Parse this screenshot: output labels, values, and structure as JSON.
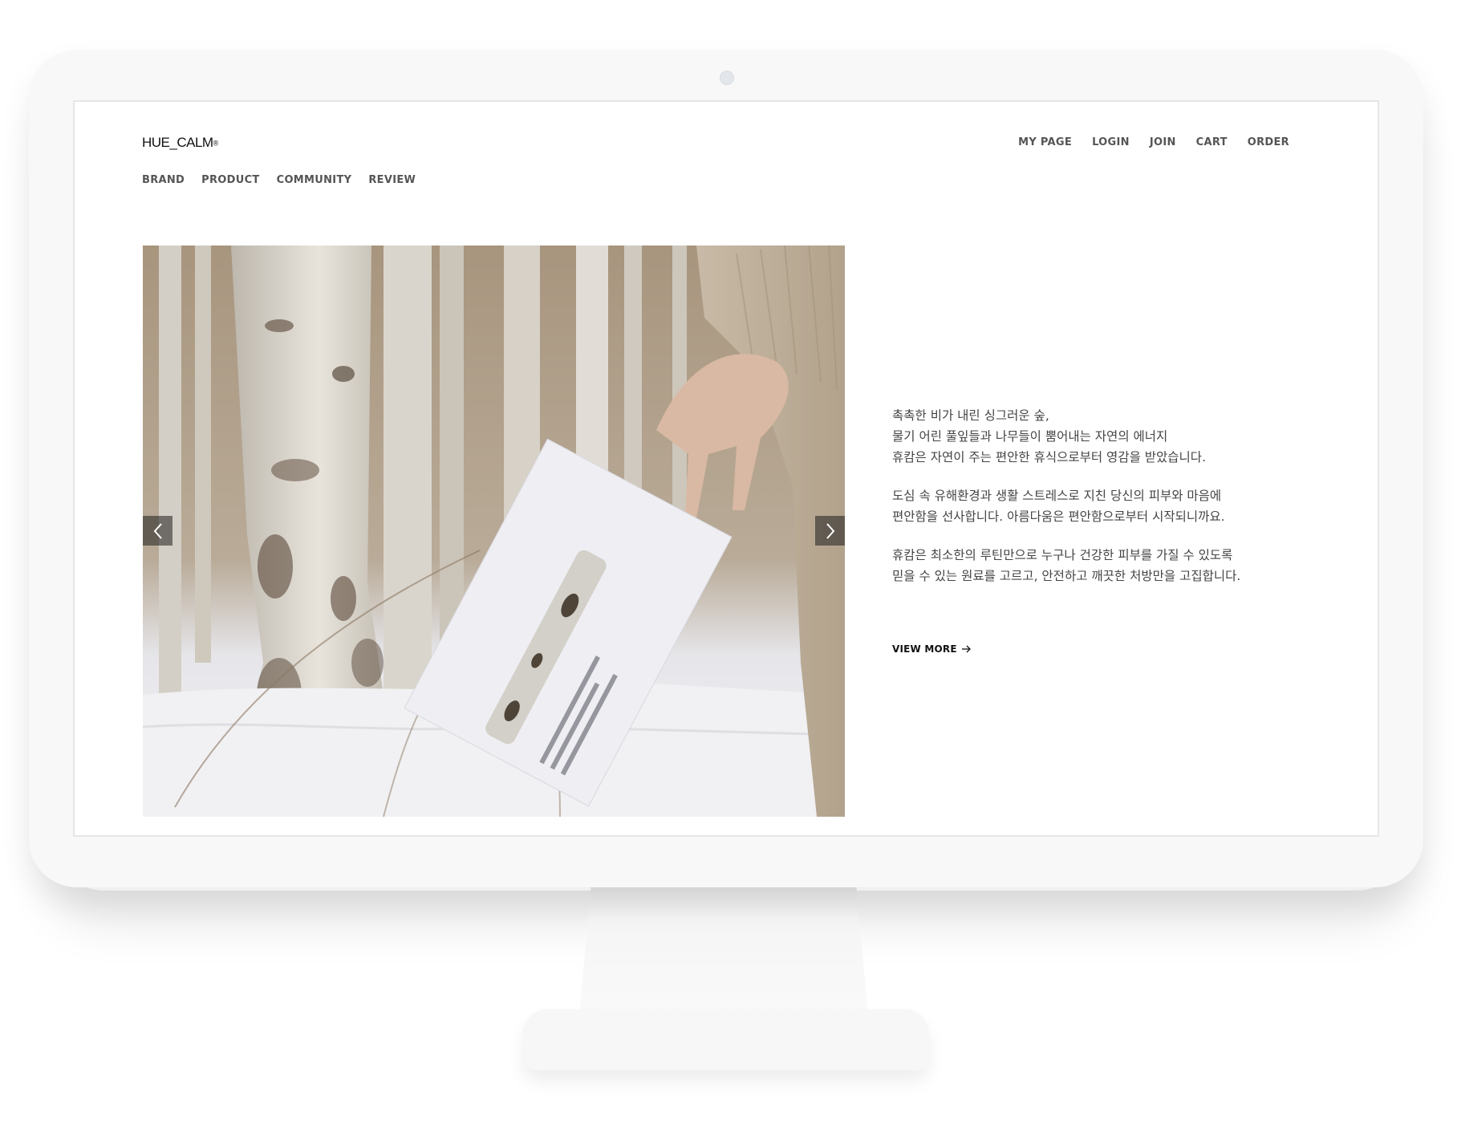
{
  "site": {
    "logo": "HUE_CALM",
    "logo_mark": "®"
  },
  "top_nav": [
    {
      "label": "MY PAGE"
    },
    {
      "label": "LOGIN"
    },
    {
      "label": "JOIN"
    },
    {
      "label": "CART"
    },
    {
      "label": "ORDER"
    }
  ],
  "main_nav": [
    {
      "label": "BRAND"
    },
    {
      "label": "PRODUCT"
    },
    {
      "label": "COMMUNITY"
    },
    {
      "label": "REVIEW"
    }
  ],
  "slider": {
    "prev_icon": "chevron-left-icon",
    "next_icon": "chevron-right-icon"
  },
  "intro": {
    "paragraphs": [
      [
        "촉촉한 비가 내린 싱그러운 숲,",
        "물기 어린 풀잎들과 나무들이 뿜어내는 자연의 에너지",
        "휴캄은 자연이 주는 편안한 휴식으로부터 영감을 받았습니다."
      ],
      [
        "도심 속 유해환경과 생활 스트레스로 지친 당신의 피부와 마음에",
        "편안함을 선사합니다. 아름다움은 편안함으로부터 시작되니까요."
      ],
      [
        "휴캄은 최소한의 루틴만으로 누구나 건강한 피부를 가질 수 있도록",
        "믿을 수 있는 원료를 고르고, 안전하고 깨끗한 처방만을 고집합니다."
      ]
    ]
  },
  "view_more": {
    "label": "VIEW MORE",
    "icon": "arrow-right-icon"
  }
}
